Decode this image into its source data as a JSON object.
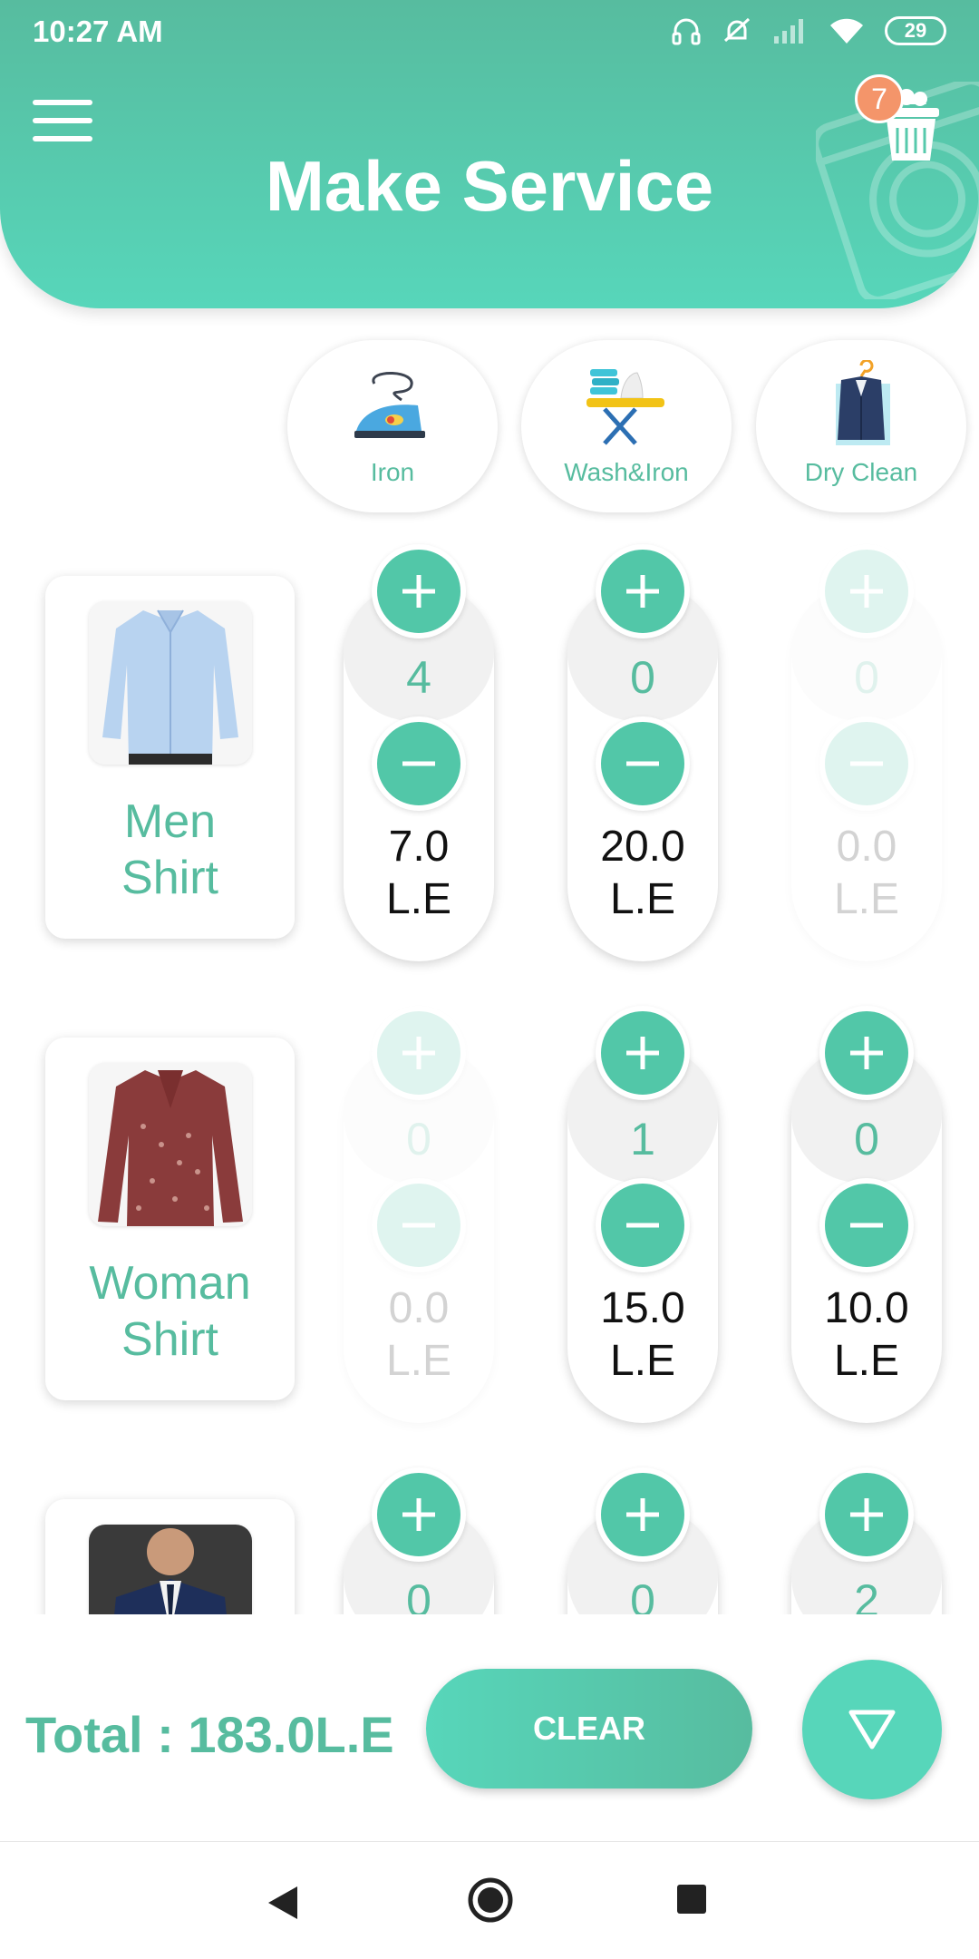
{
  "status_bar": {
    "time": "10:27 AM",
    "battery": "29"
  },
  "header": {
    "title": "Make Service",
    "cart_count": "7"
  },
  "colors": {
    "accent": "#57BC9F",
    "accent_light": "#57D6BA",
    "badge": "#F4956A"
  },
  "services": [
    {
      "label": "Iron",
      "icon": "iron-icon"
    },
    {
      "label": "Wash&Iron",
      "icon": "wash-iron-icon"
    },
    {
      "label": "Dry Clean",
      "icon": "dry-clean-icon"
    }
  ],
  "items": [
    {
      "name_line1": "Men",
      "name_line2": "Shirt",
      "columns": [
        {
          "qty": "4",
          "price": "7.0",
          "unit": "L.E",
          "enabled": true
        },
        {
          "qty": "0",
          "price": "20.0",
          "unit": "L.E",
          "enabled": true
        },
        {
          "qty": "0",
          "price": "0.0",
          "unit": "L.E",
          "enabled": false
        }
      ]
    },
    {
      "name_line1": "Woman",
      "name_line2": "Shirt",
      "columns": [
        {
          "qty": "0",
          "price": "0.0",
          "unit": "L.E",
          "enabled": false
        },
        {
          "qty": "1",
          "price": "15.0",
          "unit": "L.E",
          "enabled": true
        },
        {
          "qty": "0",
          "price": "10.0",
          "unit": "L.E",
          "enabled": true
        }
      ]
    },
    {
      "columns": [
        {
          "qty": "0"
        },
        {
          "qty": "0"
        },
        {
          "qty": "2"
        }
      ]
    }
  ],
  "footer": {
    "total": "Total :  183.0L.E",
    "clear_label": "CLEAR"
  }
}
